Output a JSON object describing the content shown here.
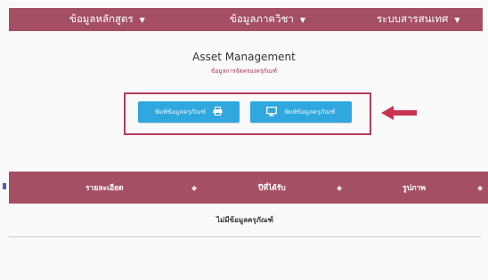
{
  "nav": {
    "items": [
      {
        "label": "ข้อมูลหลักสูตร"
      },
      {
        "label": "ข้อมูลภาควิชา"
      },
      {
        "label": "ระบบสารสนเทศ"
      }
    ]
  },
  "header": {
    "title": "Asset Management",
    "subtitle": "ข้อมูลการจัดครองครุภัณฑ์"
  },
  "actions": {
    "print_label": "พิมพ์ข้อมูลครุภัณฑ์",
    "screen_label": "พิมพ์ข้อมูลครุภัณฑ์"
  },
  "table": {
    "columns": [
      {
        "label": "รายละเอียด"
      },
      {
        "label": "ปีที่ได้รับ"
      },
      {
        "label": "รูปภาพ"
      }
    ],
    "empty_message": "ไม่มีข้อมูลครุภัณฑ์"
  },
  "colors": {
    "brand": "#a44f63",
    "button": "#2fa7df",
    "highlight": "#b93a5a"
  }
}
